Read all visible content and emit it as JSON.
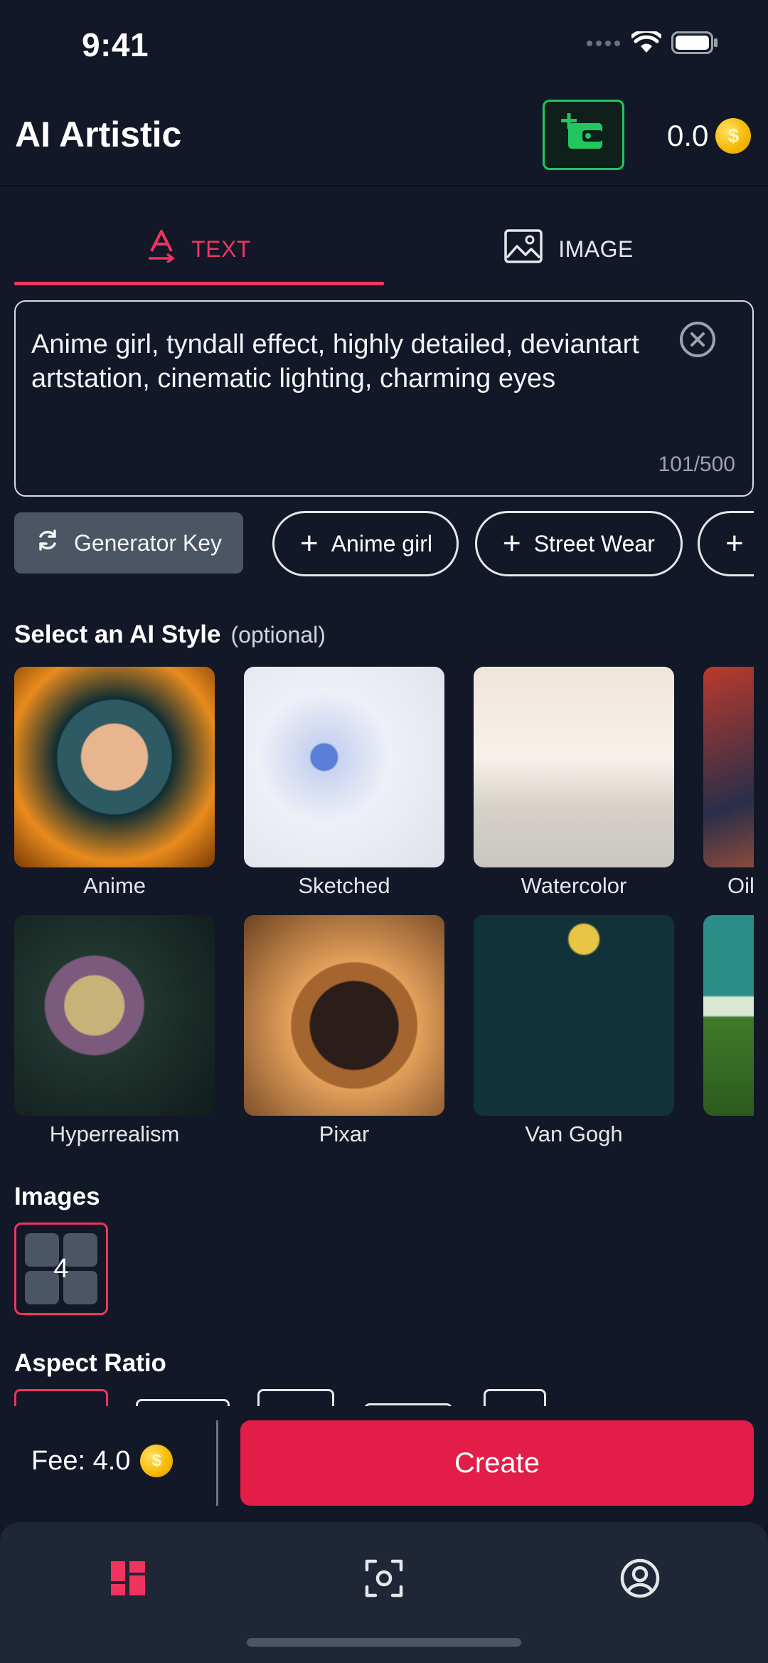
{
  "status_bar": {
    "time": "9:41"
  },
  "header": {
    "title": "AI Artistic",
    "balance": "0.0"
  },
  "tabs": [
    {
      "label": "TEXT",
      "active": true
    },
    {
      "label": "IMAGE",
      "active": false
    }
  ],
  "prompt": {
    "value": "Anime girl, tyndall effect, highly detailed, deviantart artstation, cinematic lighting, charming eyes",
    "char_count": "101/500"
  },
  "chips": {
    "generator_key": "Generator Key",
    "suggestions": [
      "Anime girl",
      "Street Wear"
    ]
  },
  "style_section": {
    "title": "Select an AI Style",
    "optional": "(optional)",
    "styles": [
      {
        "name": "Anime"
      },
      {
        "name": "Sketched"
      },
      {
        "name": "Watercolor"
      },
      {
        "name": "Oil"
      },
      {
        "name": "Hyperrealism"
      },
      {
        "name": "Pixar"
      },
      {
        "name": "Van Gogh"
      }
    ]
  },
  "images_section": {
    "title": "Images",
    "count": "4"
  },
  "aspect_ratio_section": {
    "title": "Aspect Ratio"
  },
  "footer": {
    "fee_label": "Fee: 4.0",
    "create_label": "Create"
  },
  "colors": {
    "accent": "#f0345e",
    "create": "#e11d48",
    "credit": "#22c55e",
    "background": "#121827"
  },
  "nav": {
    "icons": [
      "dashboard-icon",
      "scan-icon",
      "profile-icon"
    ]
  }
}
